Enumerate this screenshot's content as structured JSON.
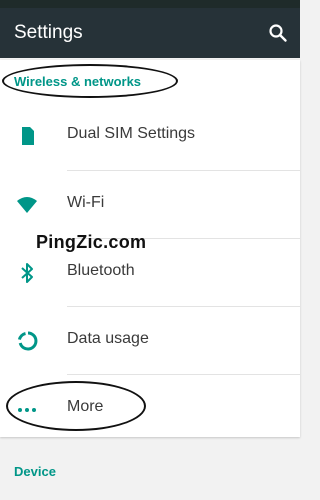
{
  "app": {
    "title": "Settings"
  },
  "sections": [
    {
      "header": "Wireless & networks",
      "items": [
        {
          "label": "Dual SIM Settings",
          "icon": "sim-card-icon"
        },
        {
          "label": "Wi-Fi",
          "icon": "wifi-icon"
        },
        {
          "label": "Bluetooth",
          "icon": "bluetooth-icon"
        },
        {
          "label": "Data usage",
          "icon": "data-usage-icon"
        },
        {
          "label": "More",
          "icon": "more-dots-icon"
        }
      ]
    },
    {
      "header": "Device"
    }
  ],
  "watermark": "PingZic.com",
  "colors": {
    "accent": "#009688",
    "appbar": "#263238"
  }
}
